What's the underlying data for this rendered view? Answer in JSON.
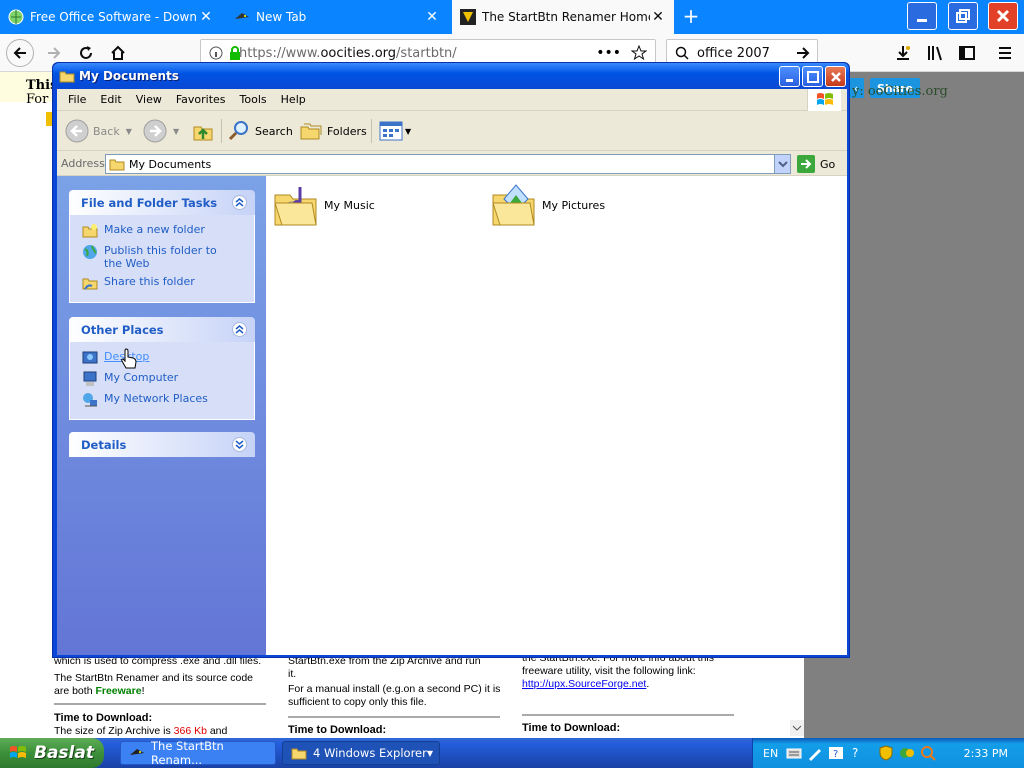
{
  "browser": {
    "tabs": [
      {
        "label": "Free Office Software - Download",
        "active": false
      },
      {
        "label": "New Tab",
        "active": false
      },
      {
        "label": "The StartBtn Renamer Home Page",
        "active": true
      }
    ],
    "url_prefix": "https://www.",
    "url_domain": "oocities.org",
    "url_path": "/startbtn/",
    "search_query": "office 2007",
    "accent": "#0a84ff"
  },
  "webpage": {
    "top_left_bold": "This",
    "top_left_for": "For :",
    "share_label": "Share",
    "top_right_text": "y: ooCities.org",
    "col1": {
      "line1": "which is used to compress .exe and .dll files.",
      "line2": "The StartBtn Renamer and its source code",
      "line3a": "are both ",
      "freeware": "Freeware",
      "line3b": "!",
      "time_head": "Time to Download:",
      "size_a": "The size of Zip Archive is ",
      "size_val": "366 Kb",
      "size_b": " and"
    },
    "col2": {
      "line1": "StartBtn.exe   from the Zip Archive and run",
      "line2": "it.",
      "line3": "For a manual install (e.g.on a second PC) it is",
      "line4": "sufficient to copy only this file.",
      "time_head": "Time to Download:"
    },
    "col3": {
      "line1": "the StartBtn.exe. For more info about this",
      "line2": "freeware utility, visit the following link:",
      "link": "http://upx.SourceForge.net",
      "link_tail": ".",
      "time_head": "Time to Download:"
    }
  },
  "explorer": {
    "title": "My Documents",
    "menu": [
      "File",
      "Edit",
      "View",
      "Favorites",
      "Tools",
      "Help"
    ],
    "toolbar": {
      "back": "Back",
      "search": "Search",
      "folders": "Folders"
    },
    "address_label": "Address",
    "address_value": "My Documents",
    "go_label": "Go",
    "panels": {
      "file_tasks": {
        "title": "File and Folder Tasks",
        "items": [
          "Make a new folder",
          "Publish this folder to the Web",
          "Share this folder"
        ]
      },
      "other_places": {
        "title": "Other Places",
        "items": [
          "Desktop",
          "My Computer",
          "My Network Places"
        ]
      },
      "details": {
        "title": "Details"
      }
    },
    "items": [
      "My Music",
      "My Pictures"
    ]
  },
  "taskbar": {
    "start_label": "Baslat",
    "buttons": [
      {
        "label": "The StartBtn Renam...",
        "active": false
      },
      {
        "label": "4 Windows Explorer",
        "active": true
      }
    ],
    "language": "EN",
    "clock": "2:33 PM"
  }
}
